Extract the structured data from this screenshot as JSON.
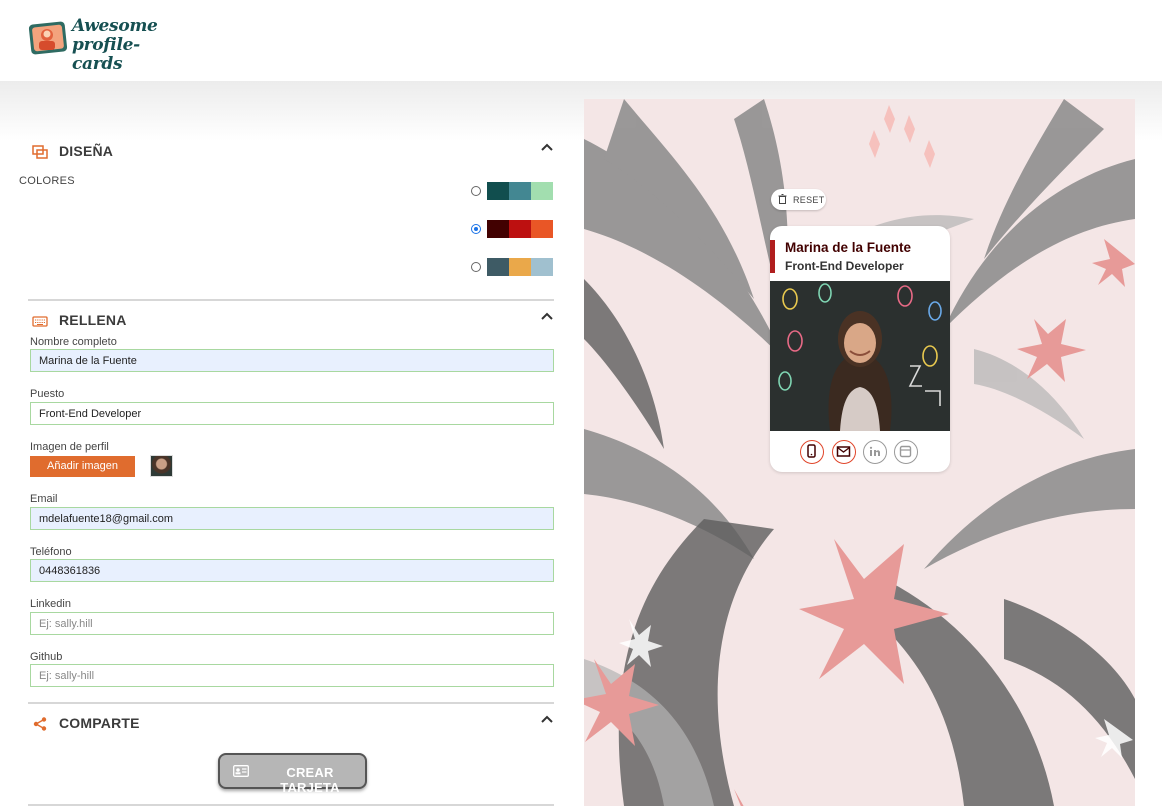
{
  "app": {
    "logo_line1": "Awesome",
    "logo_line2": "profile-cards"
  },
  "design": {
    "title": "DISEÑA",
    "colors_label": "COLORES",
    "palettes": [
      {
        "selected": false,
        "colors": [
          "#114e4e",
          "#438792",
          "#a2deaf"
        ]
      },
      {
        "selected": true,
        "colors": [
          "#420101",
          "#bd1010",
          "#e95626"
        ]
      },
      {
        "selected": false,
        "colors": [
          "#3e5b65",
          "#eaa84a",
          "#a0c0cf"
        ]
      }
    ]
  },
  "fill": {
    "title": "RELLENA",
    "name_label": "Nombre completo",
    "name_value": "Marina de la Fuente",
    "job_label": "Puesto",
    "job_value": "Front-End Developer",
    "image_label": "Imagen de perfil",
    "add_image_button": "Añadir imagen",
    "email_label": "Email",
    "email_value": "mdelafuente18@gmail.com",
    "phone_label": "Teléfono",
    "phone_value": "0448361836",
    "linkedin_label": "Linkedin",
    "linkedin_placeholder": "Ej: sally.hill",
    "github_label": "Github",
    "github_placeholder": "Ej: sally-hill"
  },
  "share": {
    "title": "COMPARTE",
    "create_button": "CREAR TARJETA"
  },
  "preview": {
    "reset_label": "RESET",
    "card_name": "Marina de la Fuente",
    "card_job": "Front-End Developer",
    "socials": [
      {
        "icon": "mobile-phone-icon",
        "active": true
      },
      {
        "icon": "envelope-icon",
        "active": true
      },
      {
        "icon": "linkedin-icon",
        "active": false
      },
      {
        "icon": "github-icon",
        "active": false
      }
    ]
  },
  "colors": {
    "accent_orange": "#e06c2e",
    "logo_teal": "#165052",
    "card_name": "#420101",
    "card_accent": "#b01e1e"
  }
}
